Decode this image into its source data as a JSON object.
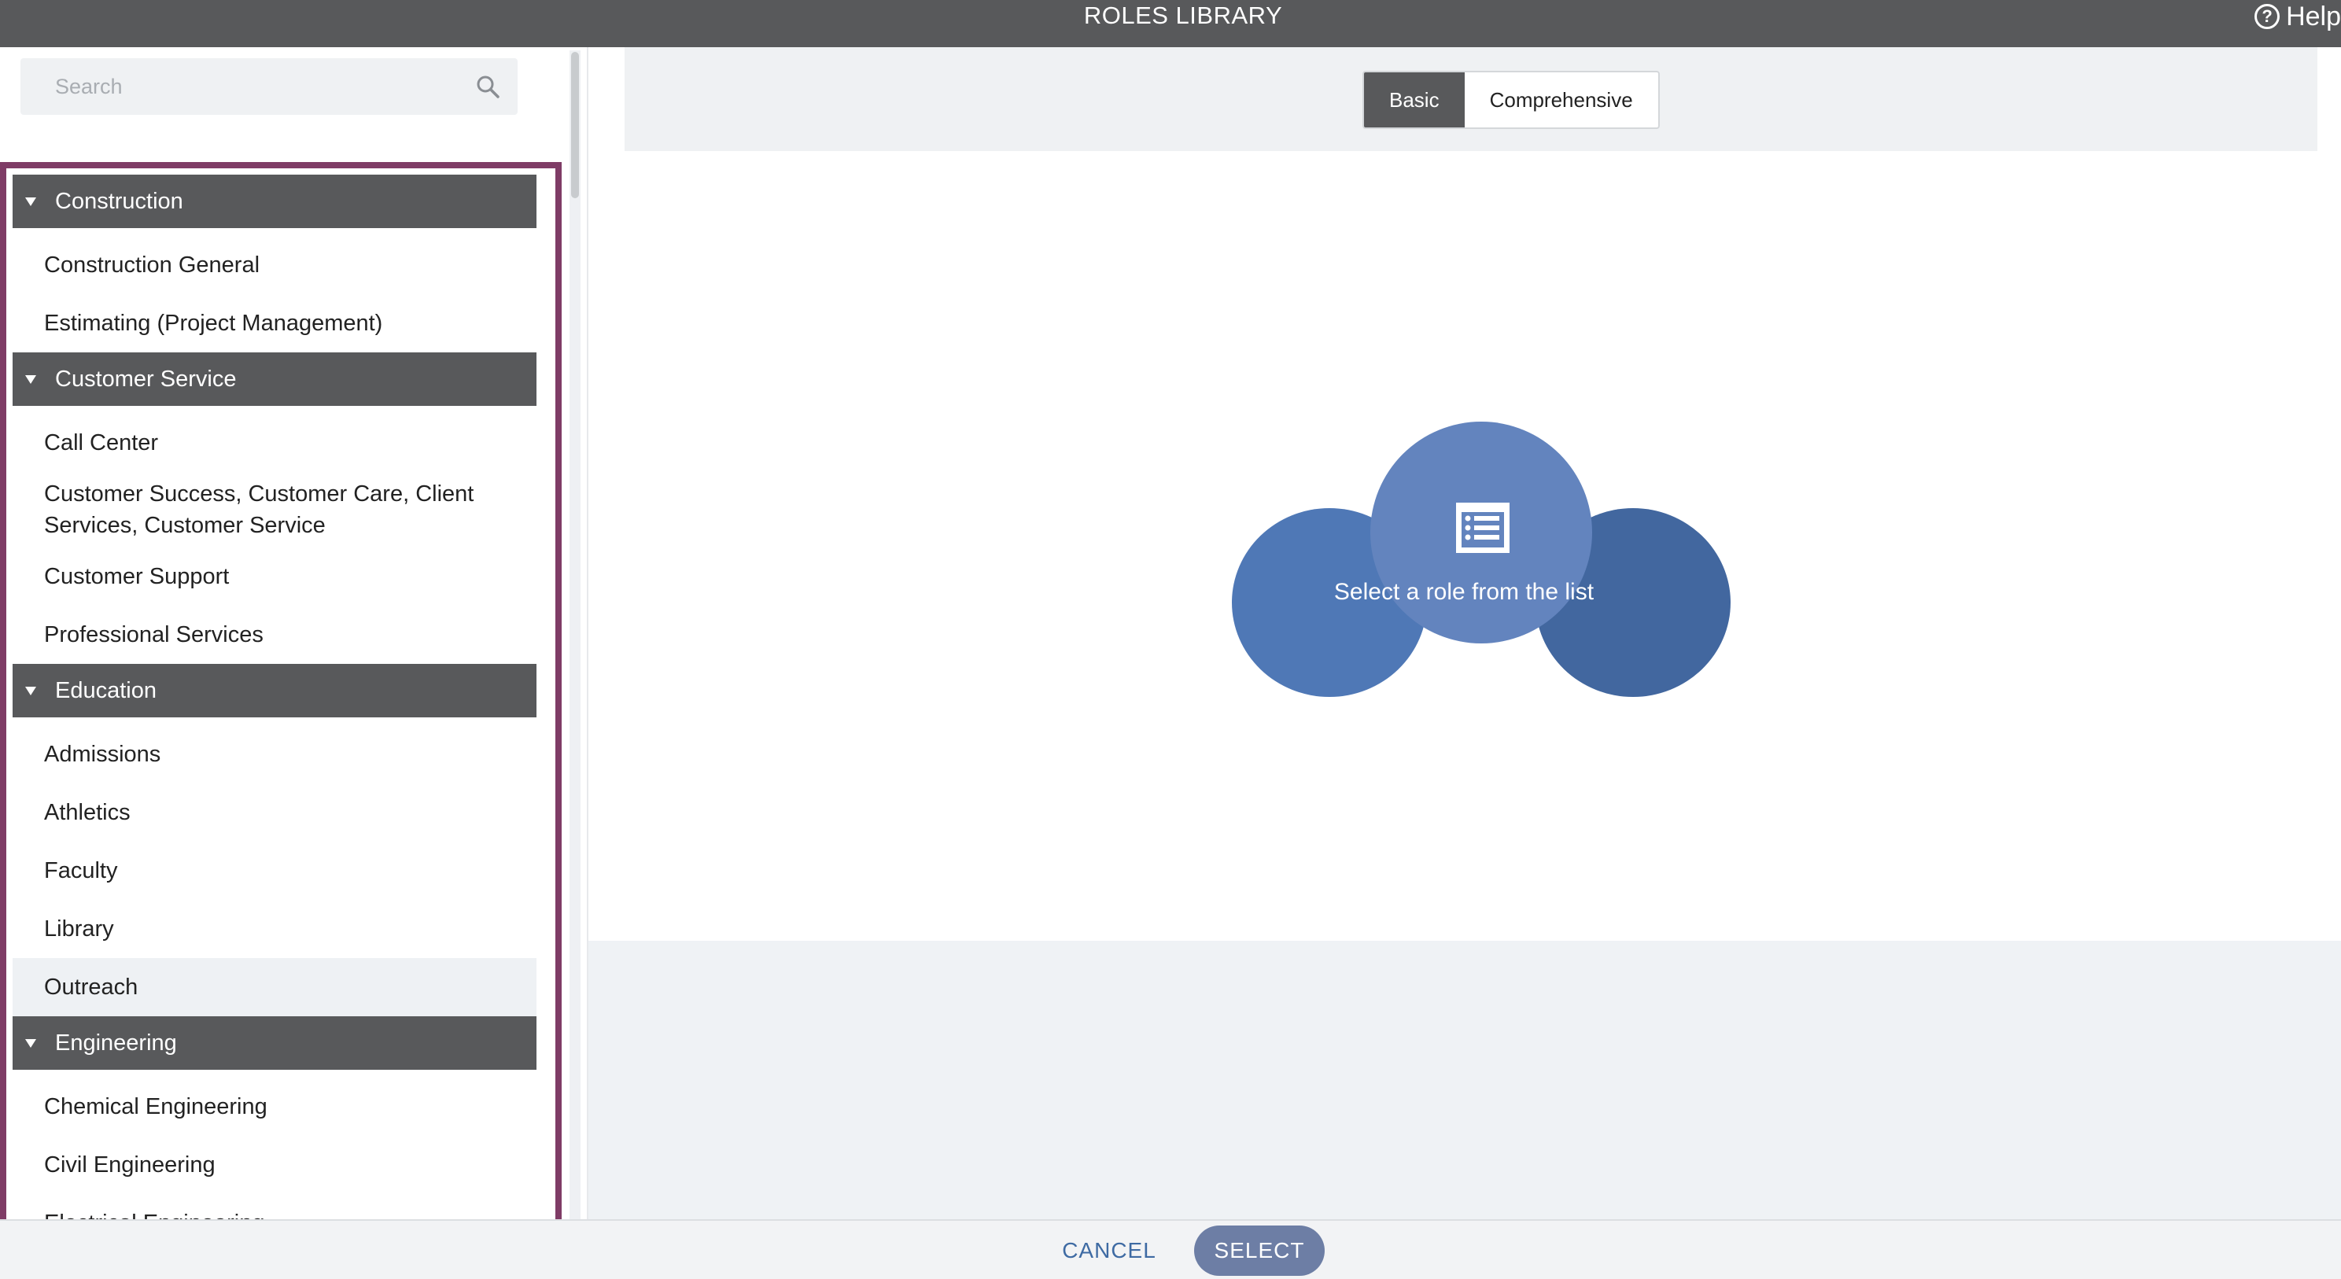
{
  "window": {
    "title": "ROLES LIBRARY",
    "help_label": "Help"
  },
  "search": {
    "placeholder": "Search"
  },
  "categories": [
    {
      "name": "Construction",
      "items": [
        "Construction General",
        "Estimating (Project Management)"
      ]
    },
    {
      "name": "Customer Service",
      "items": [
        "Call Center",
        "Customer Success, Customer Care, Client Services, Customer Service",
        "Customer Support",
        "Professional Services"
      ]
    },
    {
      "name": "Education",
      "items": [
        "Admissions",
        "Athletics",
        "Faculty",
        "Library",
        "Outreach"
      ]
    },
    {
      "name": "Engineering",
      "items": [
        "Chemical Engineering",
        "Civil Engineering",
        "Electrical Engineering"
      ]
    }
  ],
  "view_toggle": {
    "options": [
      "Basic",
      "Comprehensive"
    ],
    "selected": "Basic"
  },
  "empty_state": {
    "message": "Select a role from the list",
    "icon": "list-icon"
  },
  "footer": {
    "cancel_label": "CANCEL",
    "select_label": "SELECT"
  },
  "colors": {
    "titlebar": "#58595b",
    "highlight_border": "#7f3c66",
    "accent": "#3e6aa3",
    "select_button": "#6d7ea5"
  }
}
